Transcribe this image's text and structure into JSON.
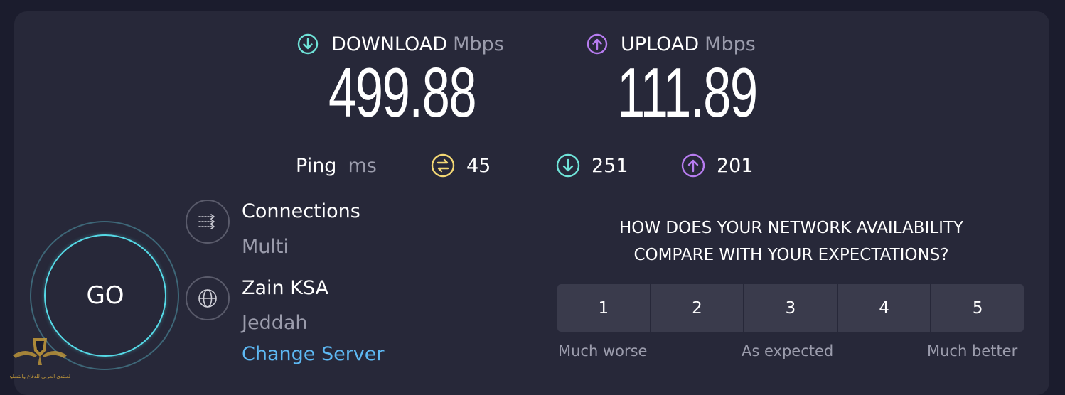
{
  "download": {
    "label": "DOWNLOAD",
    "unit": "Mbps",
    "value": "499.88",
    "icon": "arrow-down-circle-icon",
    "color": "#6fe3d8"
  },
  "upload": {
    "label": "UPLOAD",
    "unit": "Mbps",
    "value": "111.89",
    "icon": "arrow-up-circle-icon",
    "color": "#b77cf0"
  },
  "ping": {
    "label": "Ping",
    "unit": "ms",
    "idle": {
      "value": "45",
      "icon": "ping-swap-icon",
      "color": "#f3d774"
    },
    "download": {
      "value": "251",
      "icon": "arrow-down-circle-icon"
    },
    "upload": {
      "value": "201",
      "icon": "arrow-up-circle-icon"
    }
  },
  "go_label": "GO",
  "connections": {
    "title": "Connections",
    "value": "Multi",
    "icon": "connections-icon"
  },
  "server": {
    "title": "Zain KSA",
    "location": "Jeddah",
    "change_label": "Change Server",
    "icon": "globe-icon"
  },
  "survey": {
    "question_line1": "HOW DOES YOUR NETWORK AVAILABILITY",
    "question_line2": "COMPARE WITH YOUR EXPECTATIONS?",
    "options": [
      "1",
      "2",
      "3",
      "4",
      "5"
    ],
    "scale_low": "Much worse",
    "scale_mid": "As expected",
    "scale_high": "Much better"
  },
  "watermark": {
    "text": "المنتدى العربي للدفاع والتسليح",
    "icon": "eagle-shield-logo"
  }
}
